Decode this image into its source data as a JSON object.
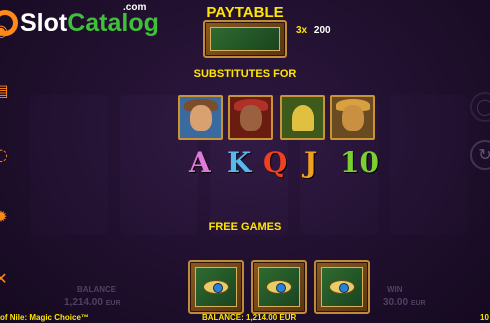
{
  "watermark": {
    "brand_prefix": "Slot",
    "brand_suffix": "Catalog",
    "domain": ".com"
  },
  "paytable": {
    "title": "PAYTABLE",
    "pay_multiplier": "3x",
    "pay_amount": "200",
    "substitutes_heading": "SUBSTITUTES FOR",
    "substitute_letters": [
      "A",
      "K",
      "Q",
      "J",
      "10"
    ],
    "free_games_heading": "FREE GAMES"
  },
  "bottom_bar": {
    "balance_label": "BALANCE",
    "balance_value": "1,214.00",
    "balance_currency": "EUR",
    "win_label": "WIN",
    "win_value": "30.00",
    "win_currency": "EUR",
    "game_name": "of Nile: Magic Choice™",
    "balance_footer": "BALANCE: 1,214.00 EUR",
    "right_edge_text": "10"
  },
  "colors": {
    "heading": "#ffe600",
    "accent_orange": "#ff8a1a",
    "brand_green": "#3fbf3a",
    "background": "#1b0f2a"
  },
  "icons": {
    "side_menu": [
      "refresh-icon",
      "paytable-icon",
      "info-icon",
      "settings-icon",
      "close-icon"
    ],
    "right_controls": [
      "spin-icon",
      "autoplay-icon"
    ]
  }
}
